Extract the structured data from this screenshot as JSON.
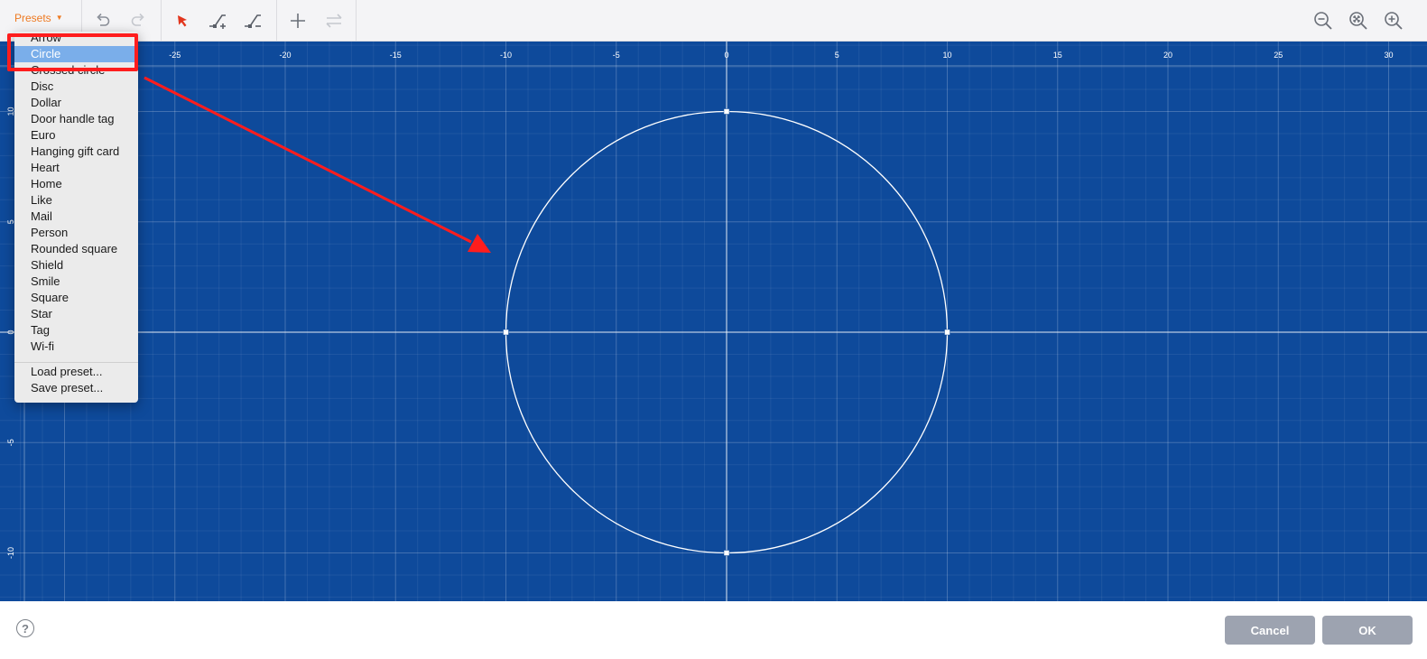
{
  "toolbar": {
    "presets_label": "Presets",
    "icons": [
      "undo-icon",
      "redo-icon",
      "select-arrow-icon",
      "add-point-icon",
      "remove-point-icon",
      "plus-icon",
      "swap-icon",
      "zoom-out-icon",
      "zoom-fit-icon",
      "zoom-in-icon"
    ],
    "accent_color": "#ee7a22"
  },
  "canvas": {
    "background": "#0e4a9b",
    "x_ticks": [
      "-25",
      "-20",
      "-15",
      "-10",
      "-5",
      "0",
      "5",
      "10",
      "15",
      "20",
      "25",
      "30"
    ],
    "y_ticks": [
      "10",
      "5",
      "0",
      "-5",
      "-10"
    ],
    "shape": {
      "type": "circle",
      "center": [
        0,
        0
      ],
      "radius": 10
    }
  },
  "presets_menu": {
    "items": [
      "Arrow",
      "Circle",
      "Crossed circle",
      "Disc",
      "Dollar",
      "Door handle tag",
      "Euro",
      "Hanging gift card",
      "Heart",
      "Home",
      "Like",
      "Mail",
      "Person",
      "Rounded square",
      "Shield",
      "Smile",
      "Square",
      "Star",
      "Tag",
      "Wi-fi"
    ],
    "selected": "Circle",
    "actions": [
      "Load preset...",
      "Save preset..."
    ]
  },
  "footer": {
    "help_label": "?",
    "cancel_label": "Cancel",
    "ok_label": "OK"
  }
}
